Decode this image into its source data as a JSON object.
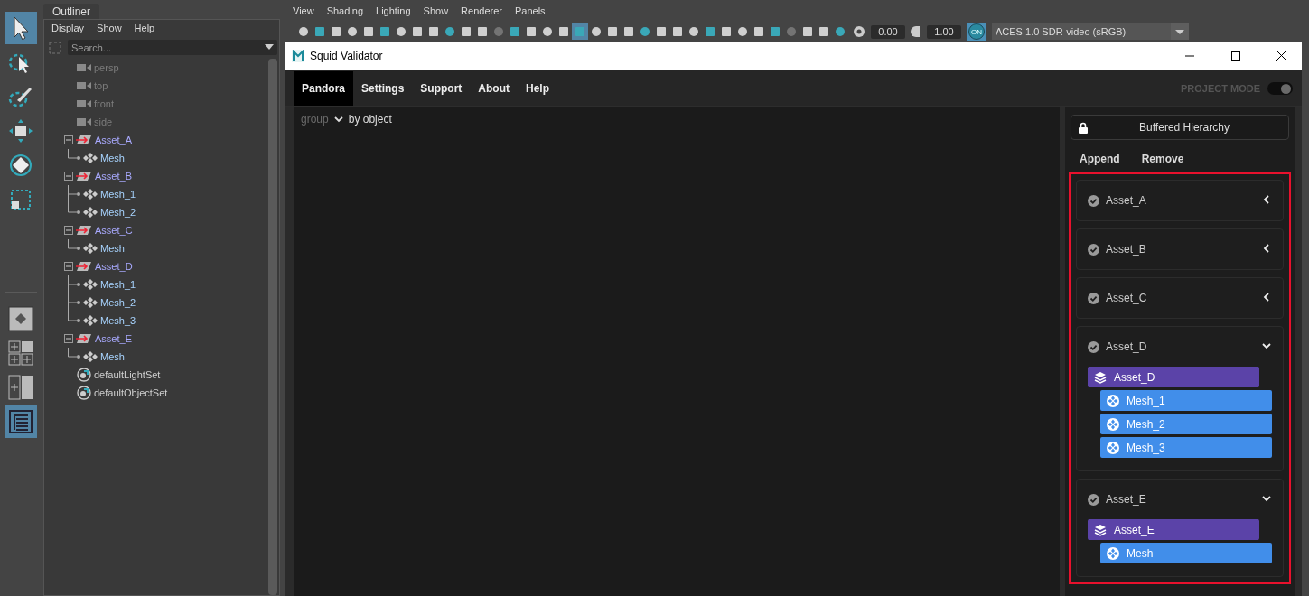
{
  "toolbox": {
    "tools": [
      {
        "kind": "select",
        "selected": true
      },
      {
        "kind": "lasso",
        "selected": false
      },
      {
        "kind": "paint",
        "selected": false
      },
      {
        "kind": "move",
        "selected": false
      },
      {
        "kind": "rotate",
        "selected": false
      },
      {
        "kind": "scale",
        "selected": false
      }
    ],
    "layouts": [
      {
        "kind": "single",
        "selected": false
      },
      {
        "kind": "quad",
        "selected": false
      },
      {
        "kind": "split",
        "selected": false
      },
      {
        "kind": "outliner",
        "selected": true
      }
    ]
  },
  "outliner": {
    "tab": "Outliner",
    "menu": [
      "Display",
      "Show",
      "Help"
    ],
    "search": {
      "placeholder": "Search..."
    },
    "items": [
      {
        "kind": "camera",
        "label": "persp"
      },
      {
        "kind": "camera",
        "label": "top"
      },
      {
        "kind": "camera",
        "label": "front"
      },
      {
        "kind": "camera",
        "label": "side"
      },
      {
        "kind": "asset",
        "label": "Asset_A",
        "expanded": true,
        "children": [
          {
            "kind": "mesh",
            "label": "Mesh"
          }
        ]
      },
      {
        "kind": "asset",
        "label": "Asset_B",
        "expanded": true,
        "children": [
          {
            "kind": "mesh",
            "label": "Mesh_1"
          },
          {
            "kind": "mesh",
            "label": "Mesh_2"
          }
        ]
      },
      {
        "kind": "asset",
        "label": "Asset_C",
        "expanded": true,
        "children": [
          {
            "kind": "mesh",
            "label": "Mesh"
          }
        ]
      },
      {
        "kind": "asset",
        "label": "Asset_D",
        "expanded": true,
        "children": [
          {
            "kind": "mesh",
            "label": "Mesh_1"
          },
          {
            "kind": "mesh",
            "label": "Mesh_2"
          },
          {
            "kind": "mesh",
            "label": "Mesh_3"
          }
        ]
      },
      {
        "kind": "asset",
        "label": "Asset_E",
        "expanded": true,
        "children": [
          {
            "kind": "mesh",
            "label": "Mesh"
          }
        ]
      },
      {
        "kind": "set",
        "label": "defaultLightSet"
      },
      {
        "kind": "set",
        "label": "defaultObjectSet"
      }
    ]
  },
  "viewport": {
    "menu": [
      "View",
      "Shading",
      "Lighting",
      "Show",
      "Renderer",
      "Panels"
    ],
    "exposure": "0.00",
    "gamma": "1.00",
    "view_transform": {
      "label": "ON",
      "on": true
    },
    "colorspace": "ACES 1.0 SDR-video (sRGB)"
  },
  "validator": {
    "title": "Squid Validator",
    "tabs": [
      {
        "label": "Pandora",
        "selected": true
      },
      {
        "label": "Settings",
        "selected": false
      },
      {
        "label": "Support",
        "selected": false
      },
      {
        "label": "About",
        "selected": false
      },
      {
        "label": "Help",
        "selected": false
      }
    ],
    "project_mode": {
      "label": "PROJECT MODE",
      "on": true
    },
    "group_by": {
      "label": "group",
      "value": "by object"
    },
    "buffered": {
      "label": "Buffered Hierarchy",
      "locked": true
    },
    "actions": [
      "Append",
      "Remove"
    ],
    "assets": [
      {
        "name": "Asset_A",
        "expanded": false
      },
      {
        "name": "Asset_B",
        "expanded": false
      },
      {
        "name": "Asset_C",
        "expanded": false
      },
      {
        "name": "Asset_D",
        "expanded": true,
        "items": [
          {
            "kind": "group",
            "label": "Asset_D",
            "children": [
              {
                "kind": "mesh",
                "label": "Mesh_1"
              },
              {
                "kind": "mesh",
                "label": "Mesh_2"
              },
              {
                "kind": "mesh",
                "label": "Mesh_3"
              }
            ]
          }
        ]
      },
      {
        "name": "Asset_E",
        "expanded": true,
        "items": [
          {
            "kind": "group",
            "label": "Asset_E",
            "children": [
              {
                "kind": "mesh",
                "label": "Mesh"
              }
            ]
          }
        ]
      }
    ]
  }
}
